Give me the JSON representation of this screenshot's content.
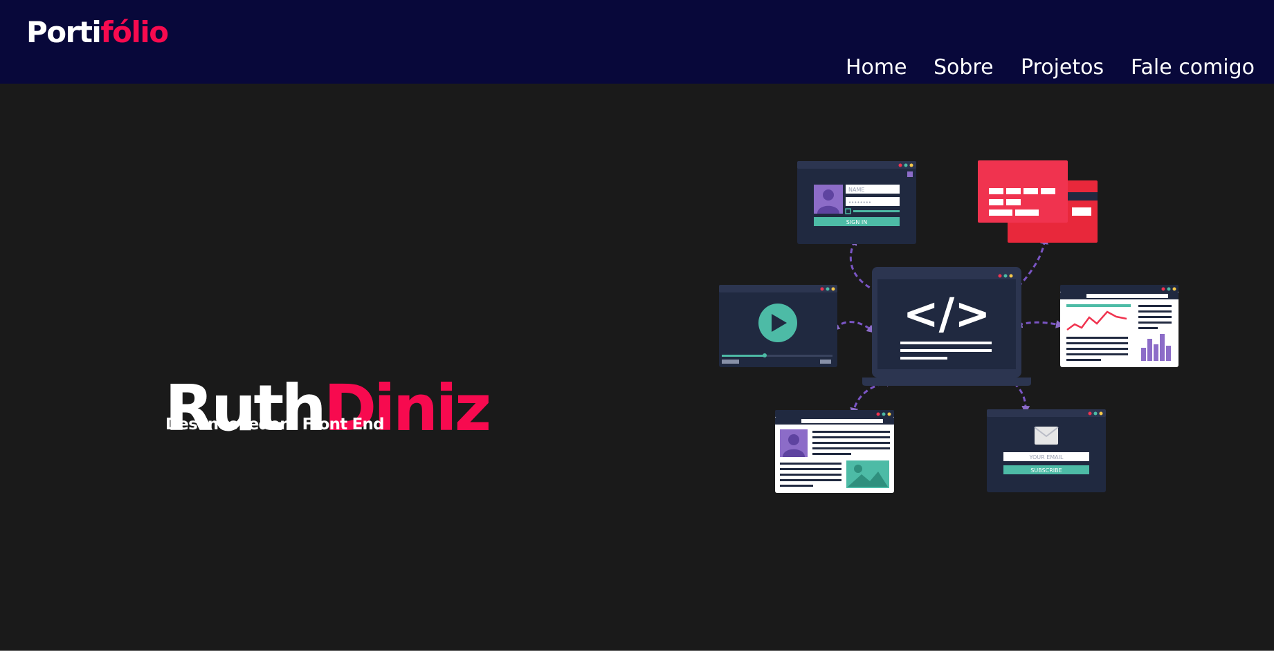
{
  "logo": {
    "part1": "Porti",
    "part2": "fólio"
  },
  "nav": {
    "items": [
      {
        "label": "Home"
      },
      {
        "label": "Sobre"
      },
      {
        "label": "Projetos"
      },
      {
        "label": "Fale comigo"
      }
    ]
  },
  "hero": {
    "first_name": "Ruth",
    "last_name": "Diniz",
    "role": "Desenvovedora Front End"
  },
  "illustration": {
    "code_symbol": "</>",
    "name_placeholder": "NAME",
    "password_placeholder": "••••••••",
    "signin_label": "SIGN IN",
    "email_placeholder": "YOUR EMAIL",
    "subscribe_label": "SUBSCRIBE"
  },
  "colors": {
    "header_bg": "#08083a",
    "hero_bg": "#1a1a1a",
    "accent": "#f70a4f",
    "panel_dark": "#202940",
    "teal": "#4dbba6",
    "purple": "#8c6cc8",
    "card_red": "#f0334f"
  }
}
